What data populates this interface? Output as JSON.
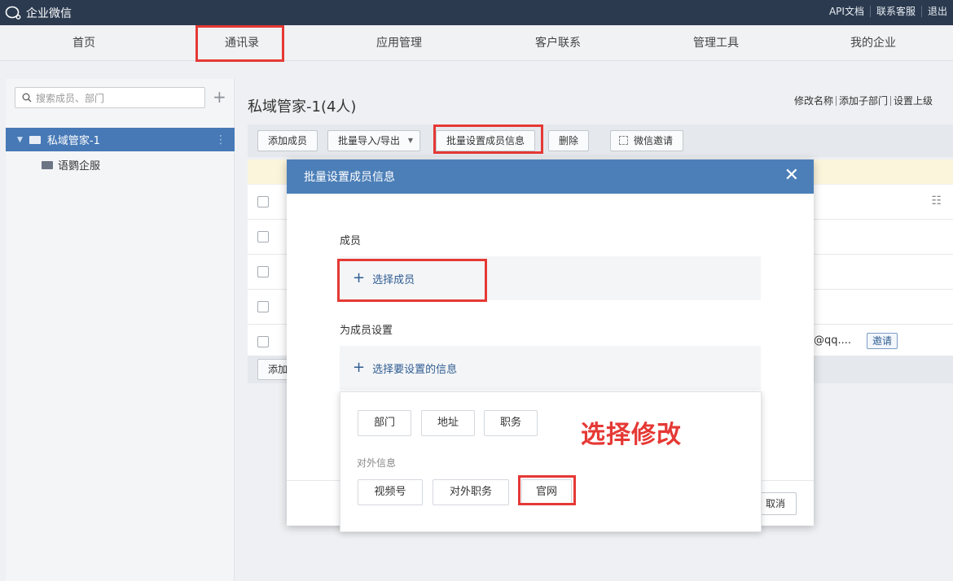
{
  "app": {
    "title": "企业微信"
  },
  "top_links": [
    "API文档",
    "联系客服",
    "退出"
  ],
  "nav": {
    "items": [
      "首页",
      "通讯录",
      "应用管理",
      "客户联系",
      "管理工具",
      "我的企业"
    ],
    "active": "通讯录"
  },
  "sidebar": {
    "search_placeholder": "搜索成员、部门",
    "root": "私域管家-1",
    "children": [
      "语鹦企服"
    ]
  },
  "main": {
    "dept_title": "私域管家-1(4人)",
    "dept_actions": [
      "修改名称",
      "添加子部门",
      "设置上级"
    ],
    "toolbar": {
      "add_member": "添加成员",
      "import_export": "批量导入/导出",
      "batch_set": "批量设置成员信息",
      "delete": "删除",
      "wechat_invite": "微信邀请"
    },
    "row_email_fragment": "@qq....",
    "row_invite": "邀请",
    "bottom_add": "添加"
  },
  "modal": {
    "title": "批量设置成员信息",
    "member_label": "成员",
    "select_member": "选择成员",
    "set_label": "为成员设置",
    "select_info": "选择要设置的信息",
    "cancel": "取消"
  },
  "dropdown": {
    "basic_options": [
      "部门",
      "地址",
      "职务"
    ],
    "external_label": "对外信息",
    "external_options": [
      "视频号",
      "对外职务",
      "官网"
    ]
  },
  "annotation": "选择修改",
  "colors": {
    "topbar": "#2b3a4f",
    "accent": "#4c7fb8",
    "highlight": "#e53935"
  }
}
